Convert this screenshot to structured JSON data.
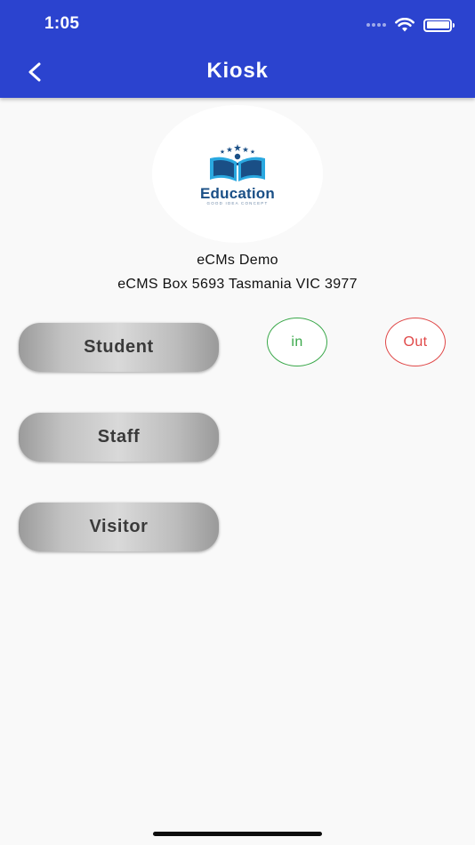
{
  "status_bar": {
    "time": "1:05",
    "icons": [
      "signal-dots-icon",
      "wifi-icon",
      "battery-icon"
    ]
  },
  "nav": {
    "title": "Kiosk",
    "back_icon": "chevron-left-icon"
  },
  "logo": {
    "text": "Education",
    "tagline": "GOOD IDEA CONCEPT",
    "colors": {
      "primary": "#1a4f86",
      "accent": "#2aa8e0"
    }
  },
  "organization": {
    "name": "eCMs Demo",
    "address": "eCMS Box 5693 Tasmania VIC 3977"
  },
  "categories": [
    {
      "label": "Student"
    },
    {
      "label": "Staff"
    },
    {
      "label": "Visitor"
    }
  ],
  "actions": {
    "in_label": "in",
    "out_label": "Out"
  },
  "colors": {
    "header": "#2b43cf",
    "background": "#f9f9f9",
    "in": "#3aa84a",
    "out": "#e04848"
  }
}
